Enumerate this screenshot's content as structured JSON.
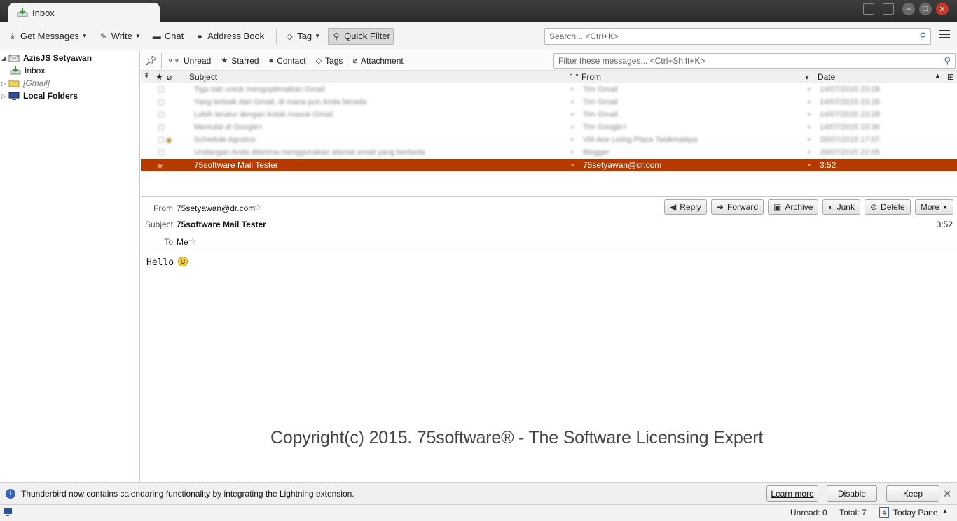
{
  "window": {
    "tab_label": "Inbox"
  },
  "toolbar": {
    "get_messages": "Get Messages",
    "write": "Write",
    "chat": "Chat",
    "address_book": "Address Book",
    "tag": "Tag",
    "quick_filter": "Quick Filter",
    "search_placeholder": "Search... <Ctrl+K>"
  },
  "folders": {
    "account": "AzisJS Setyawan",
    "inbox": "Inbox",
    "gmail": "[Gmail]",
    "local": "Local Folders"
  },
  "quick_filter": {
    "unread": "Unread",
    "starred": "Starred",
    "contact": "Contact",
    "tags": "Tags",
    "attachment": "Attachment",
    "filter_placeholder": "Filter these messages... <Ctrl+Shift+K>"
  },
  "thread_columns": {
    "subject": "Subject",
    "from": "From",
    "date": "Date"
  },
  "threads": [
    {
      "subject": "Tiga tiati untuk mengoptimalkan Gmail",
      "from": "Tim Gmail",
      "date": "14/07/2015 23:28"
    },
    {
      "subject": "Yang terbaik dari Gmail, di mana pun Anda berada",
      "from": "Tim Gmail",
      "date": "14/07/2015 23:28"
    },
    {
      "subject": "Lebih teratur dengan kotak masuk Gmail",
      "from": "Tim Gmail",
      "date": "14/07/2015 23:28"
    },
    {
      "subject": "Memulai di Google+",
      "from": "Tim Google+",
      "date": "14/07/2015 23:36"
    },
    {
      "subject": "Schedule Agustus",
      "from": "VM Ace Living Plaza Tasikmalaya",
      "date": "26/07/2015 17:07"
    },
    {
      "subject": "Undangan Anda diterima menggunakan alamat email yang berbeda",
      "from": "Blogger",
      "date": "26/07/2015 22:05"
    },
    {
      "subject": "75software Mail Tester",
      "from": "75setyawan@dr.com",
      "date": "3:52"
    }
  ],
  "message": {
    "from_label": "From",
    "from": "75setyawan@dr.com",
    "subject_label": "Subject",
    "subject": "75software Mail Tester",
    "to_label": "To",
    "to": "Me",
    "time": "3:52",
    "buttons": {
      "reply": "Reply",
      "forward": "Forward",
      "archive": "Archive",
      "junk": "Junk",
      "delete": "Delete",
      "more": "More"
    },
    "body": "Hello",
    "copyright": "Copyright(c) 2015. 75software® - The Software Licensing Expert"
  },
  "notification": {
    "text": "Thunderbird now contains calendaring functionality by integrating the Lightning extension.",
    "learn_more": "Learn more",
    "disable": "Disable",
    "keep": "Keep"
  },
  "status": {
    "unread": "Unread: 0",
    "total": "Total: 7",
    "today_pane": "Today Pane",
    "calendar_day": "4"
  },
  "colors": {
    "selection": "#b53a00",
    "accent": "#3a68b8"
  }
}
